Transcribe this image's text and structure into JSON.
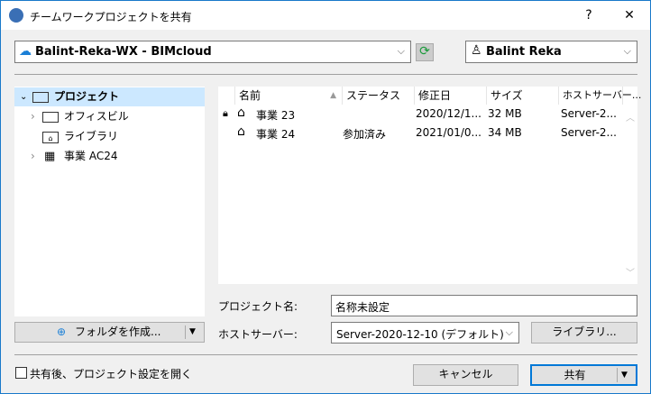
{
  "window": {
    "title": "チームワークプロジェクトを共有",
    "help": "?",
    "close": "✕"
  },
  "server": {
    "label": "Balint-Reka-WX - BIMcloud"
  },
  "user": {
    "label": "Balint Reka"
  },
  "tree": [
    {
      "label": "プロジェクト",
      "expanded": true,
      "selected": true
    },
    {
      "label": "オフィスビル"
    },
    {
      "label": "ライブラリ"
    },
    {
      "label": "事業 AC24"
    }
  ],
  "list": {
    "columns": [
      "名前",
      "ステータス",
      "修正日",
      "サイズ",
      "ホストサーバー..."
    ],
    "rows": [
      {
        "name": "事業 23",
        "status": "",
        "date": "2020/12/1...",
        "size": "32 MB",
        "host": "Server-2..."
      },
      {
        "name": "事業 24",
        "status": "参加済み",
        "date": "2021/01/0...",
        "size": "34 MB",
        "host": "Server-2..."
      }
    ]
  },
  "form": {
    "project_name_label": "プロジェクト名:",
    "project_name": "名称未設定",
    "host_label": "ホストサーバー:",
    "host_value": "Server-2020-12-10 (デフォルト)",
    "library_button": "ライブラリ..."
  },
  "new_folder_button": "フォルダを作成...",
  "footer": {
    "checkbox_label": "共有後、プロジェクト設定を開く",
    "cancel": "キャンセル",
    "share": "共有"
  }
}
